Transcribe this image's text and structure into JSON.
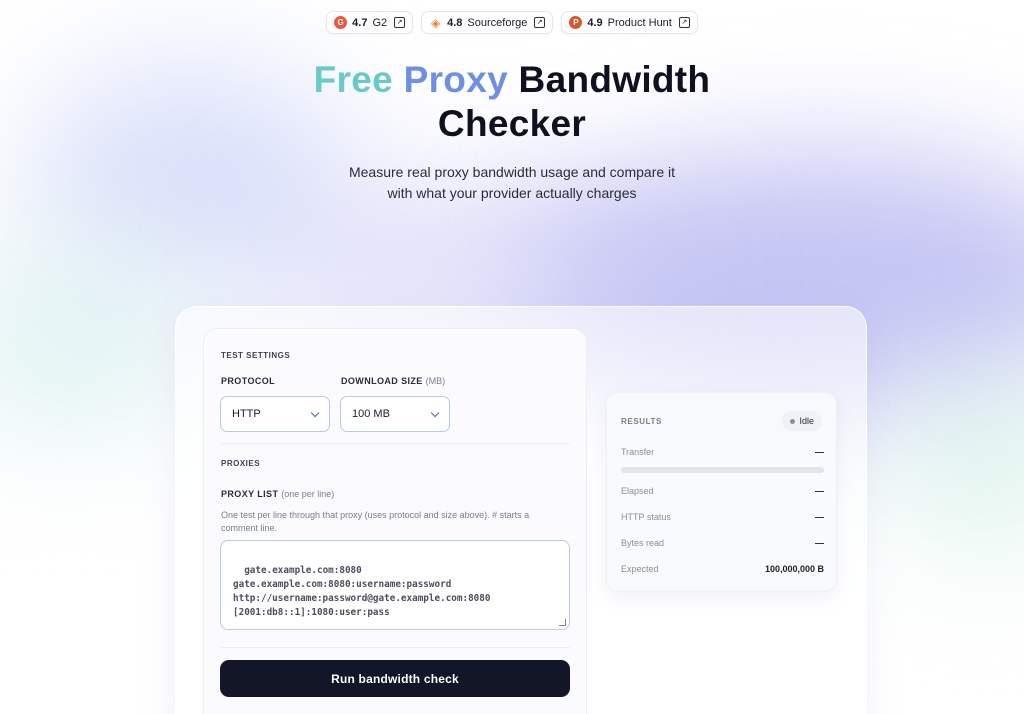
{
  "ratings": [
    {
      "logo": "G",
      "score": "4.7",
      "name": "G2",
      "icon": "g2-logo-icon"
    },
    {
      "logo": "◈",
      "score": "4.8",
      "name": "Sourceforge",
      "icon": "sourceforge-logo-icon"
    },
    {
      "logo": "P",
      "score": "4.9",
      "name": "Product Hunt",
      "icon": "producthunt-logo-icon"
    }
  ],
  "hero": {
    "title_free": "Free",
    "title_proxy": "Proxy",
    "title_rest_1": "Bandwidth",
    "title_rest_2": "Checker",
    "subtitle_line1": "Measure real proxy bandwidth usage and compare it",
    "subtitle_line2": "with what your provider actually charges"
  },
  "settings": {
    "section_label": "TEST SETTINGS",
    "protocol_label": "PROTOCOL",
    "protocol_value": "HTTP",
    "download_label": "DOWNLOAD SIZE",
    "download_unit": "(MB)",
    "download_value": "100 MB",
    "proxies_label": "PROXIES",
    "proxy_list_label": "PROXY LIST",
    "proxy_list_hint_inline": "(one per line)",
    "proxy_list_help_1": "One test per line through that proxy (uses protocol and size above). # starts a",
    "proxy_list_help_2": "comment line.",
    "proxy_list_placeholder": "gate.example.com:8080\ngate.example.com:8080:username:password\nhttp://username:password@gate.example.com:8080\n[2001:db8::1]:1080:user:pass",
    "run_button": "Run bandwidth check"
  },
  "results": {
    "title": "RESULTS",
    "status": "Idle",
    "progress": 0,
    "rows": [
      {
        "label": "Transfer",
        "value": "—"
      },
      {
        "label": "Elapsed",
        "value": "—"
      },
      {
        "label": "HTTP status",
        "value": "—"
      },
      {
        "label": "Bytes read",
        "value": "—"
      },
      {
        "label": "Expected",
        "value": "100,000,000 B"
      }
    ]
  },
  "colors": {
    "accent_teal": "#6cc9c9",
    "accent_blue": "#6f8fe5",
    "button_dark": "#121626"
  }
}
